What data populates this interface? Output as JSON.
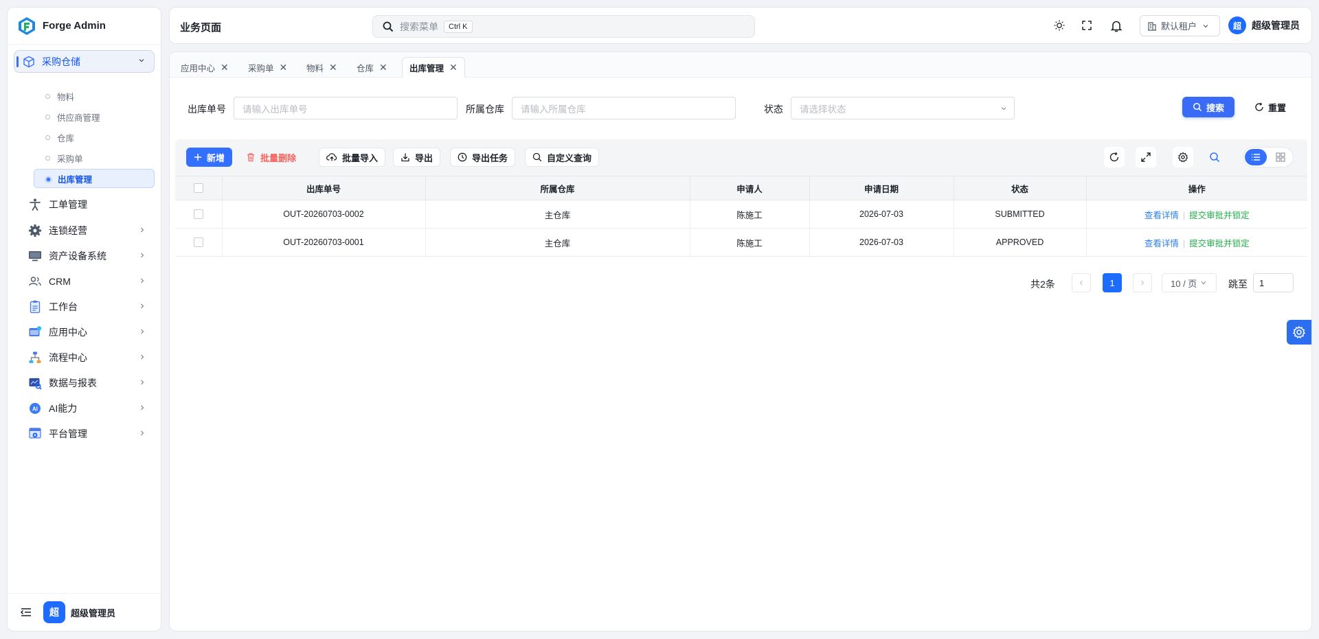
{
  "app": {
    "name": "Forge Admin"
  },
  "sidebar": {
    "parent": {
      "label": "采购仓储",
      "icon": "package-icon"
    },
    "sub_items": [
      {
        "label": "物料",
        "active": false
      },
      {
        "label": "供应商管理",
        "active": false
      },
      {
        "label": "仓库",
        "active": false
      },
      {
        "label": "采购单",
        "active": false
      },
      {
        "label": "出库管理",
        "active": true
      }
    ],
    "items": [
      {
        "label": "工单管理",
        "icon": "accessibility-icon",
        "arrow": false
      },
      {
        "label": "连锁经营",
        "icon": "gear-icon",
        "arrow": true
      },
      {
        "label": "资产设备系统",
        "icon": "monitor-icon",
        "arrow": true
      },
      {
        "label": "CRM",
        "icon": "users-icon",
        "arrow": true
      },
      {
        "label": "工作台",
        "icon": "clipboard-icon",
        "arrow": true
      },
      {
        "label": "应用中心",
        "icon": "app-icon",
        "arrow": true
      },
      {
        "label": "流程中心",
        "icon": "flow-icon",
        "arrow": true
      },
      {
        "label": "数据与报表",
        "icon": "report-icon",
        "arrow": true
      },
      {
        "label": "AI能力",
        "icon": "ai-icon",
        "arrow": true
      },
      {
        "label": "平台管理",
        "icon": "platform-icon",
        "arrow": true
      }
    ],
    "footer": {
      "avatar": "超",
      "name": "超级管理员"
    }
  },
  "header": {
    "page_title": "业务页面",
    "search_placeholder": "搜索菜单",
    "search_shortcut": "Ctrl K",
    "tenant": "默认租户",
    "user_avatar": "超",
    "user_name": "超级管理员"
  },
  "tabs": [
    {
      "label": "应用中心",
      "active": false
    },
    {
      "label": "采购单",
      "active": false
    },
    {
      "label": "物料",
      "active": false
    },
    {
      "label": "仓库",
      "active": false
    },
    {
      "label": "出库管理",
      "active": true
    }
  ],
  "query": {
    "order_no_label": "出库单号",
    "order_no_placeholder": "请输入出库单号",
    "warehouse_label": "所属仓库",
    "warehouse_placeholder": "请输入所属仓库",
    "status_label": "状态",
    "status_placeholder": "请选择状态",
    "search_btn": "搜索",
    "reset_btn": "重置"
  },
  "toolbar": {
    "add": "新增",
    "batch_delete": "批量删除",
    "batch_import": "批量导入",
    "export": "导出",
    "export_tasks": "导出任务",
    "custom_query": "自定义查询"
  },
  "table": {
    "columns": [
      "出库单号",
      "所属仓库",
      "申请人",
      "申请日期",
      "状态",
      "操作"
    ],
    "rows": [
      {
        "order_no": "OUT-20260703-0002",
        "warehouse": "主仓库",
        "applicant": "陈施工",
        "date": "2026-07-03",
        "status": "SUBMITTED",
        "action_view": "查看详情",
        "action_submit": "提交审批并锁定"
      },
      {
        "order_no": "OUT-20260703-0001",
        "warehouse": "主仓库",
        "applicant": "陈施工",
        "date": "2026-07-03",
        "status": "APPROVED",
        "action_view": "查看详情",
        "action_submit": "提交审批并锁定"
      }
    ]
  },
  "pagination": {
    "total": "共2条",
    "current": "1",
    "page_size": "10 / 页",
    "jump_label": "跳至",
    "jump_value": "1"
  },
  "colors": {
    "primary": "#3370ff",
    "danger": "#f76560",
    "link": "#2f7ff0",
    "success": "#23b04a"
  }
}
